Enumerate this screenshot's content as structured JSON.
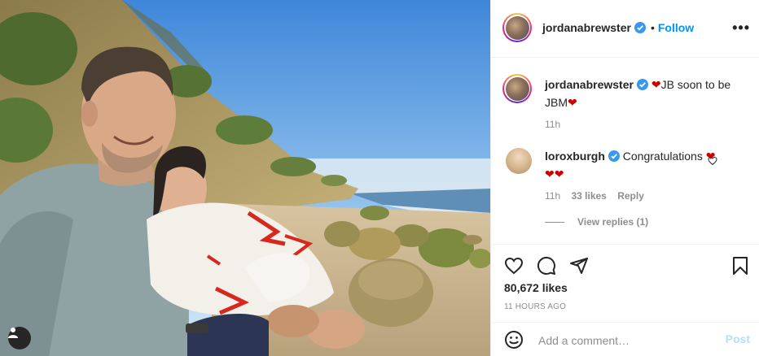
{
  "post": {
    "author": "jordanabrewster",
    "follow_label": "Follow",
    "more_label": "•••",
    "caption_text": "JB soon to be JBM",
    "caption_time": "11h"
  },
  "comments": [
    {
      "author": "loroxburgh",
      "text": "Congratulations",
      "time": "11h",
      "likes": "33 likes",
      "reply_label": "Reply",
      "view_replies": "View replies (1)"
    }
  ],
  "stats": {
    "likes": "80,672 likes",
    "time_ago": "11 HOURS AGO"
  },
  "comment_box": {
    "placeholder": "Add a comment…",
    "post_label": "Post"
  },
  "colors": {
    "accent": "#0095f6",
    "verified": "#3897f0",
    "heart": "#cc0000",
    "post_disabled": "#b2dffc"
  },
  "icons": [
    "verified-badge-icon",
    "heart-icon",
    "comment-icon",
    "share-icon",
    "save-icon",
    "emoji-icon",
    "user-tag-icon",
    "more-options-icon"
  ]
}
